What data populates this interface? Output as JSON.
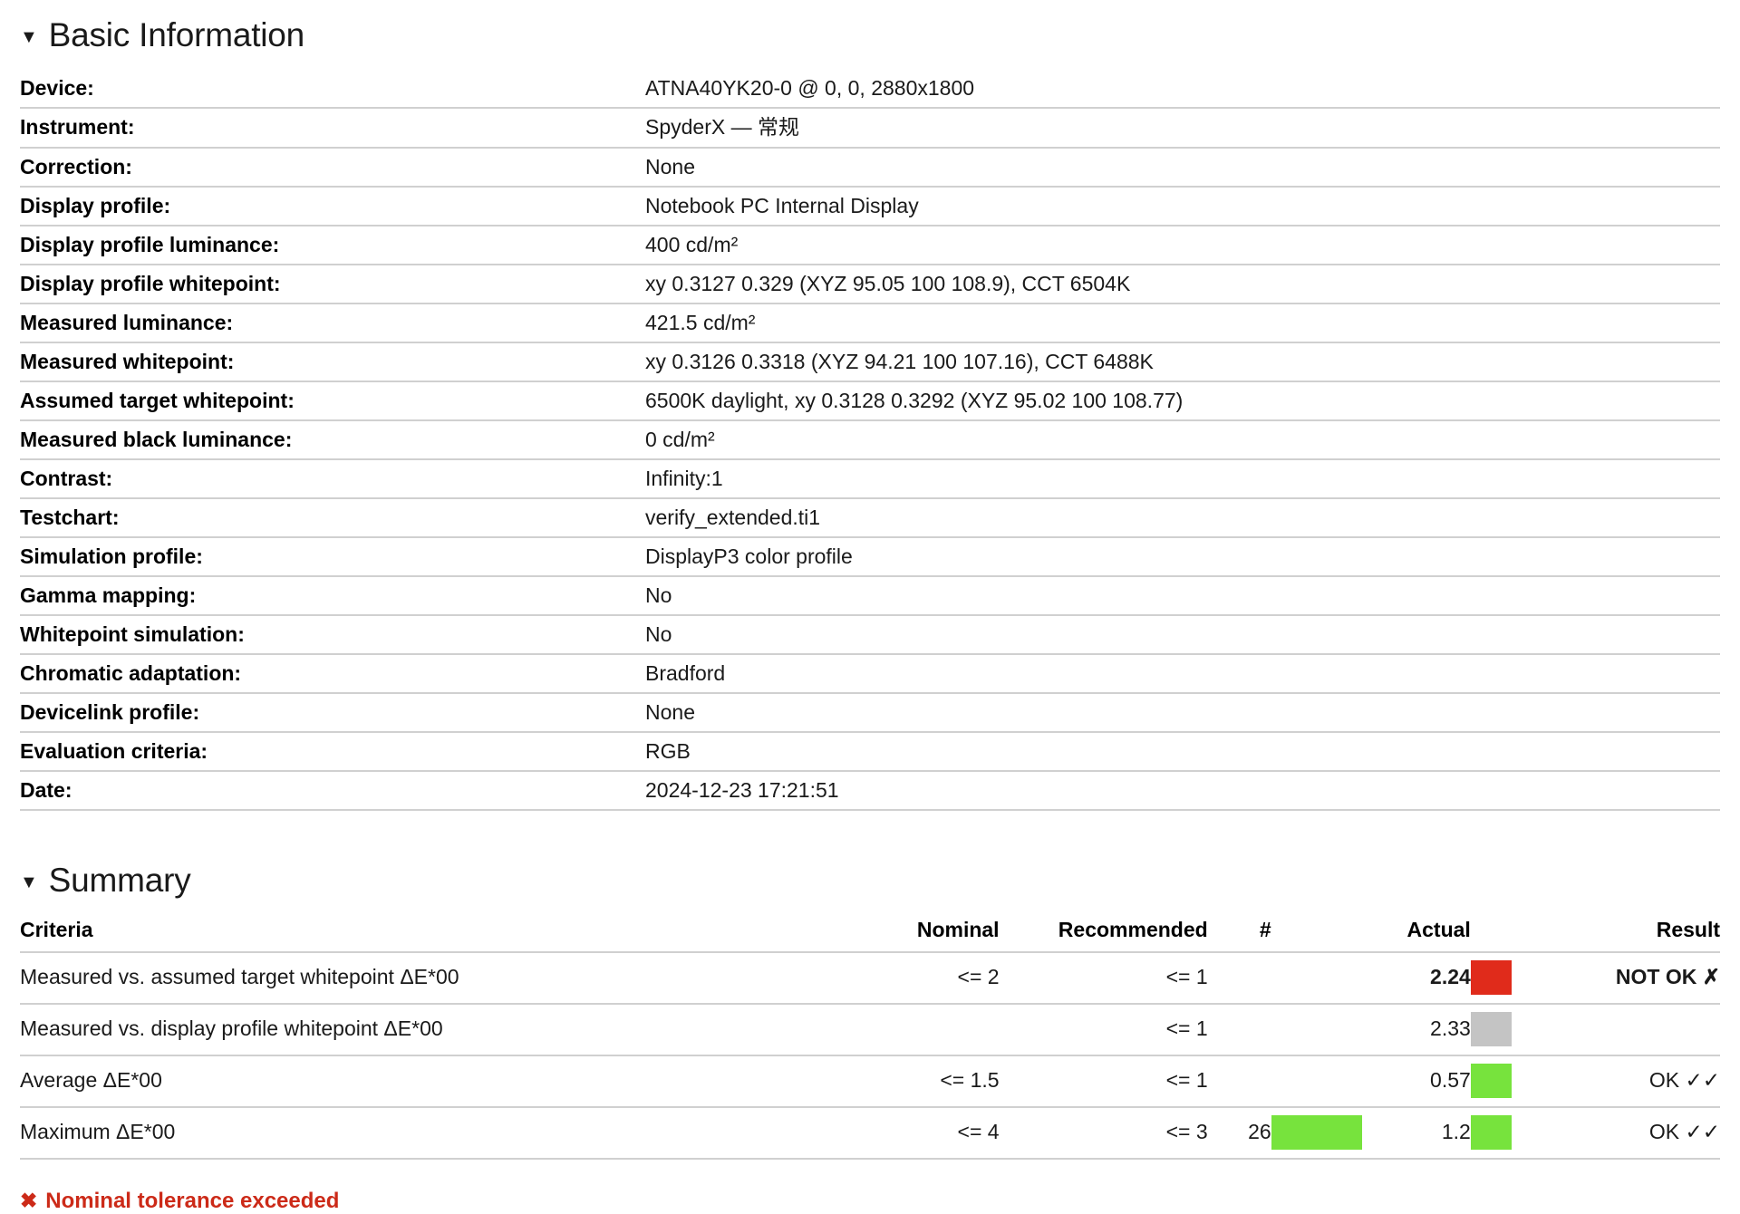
{
  "sections": {
    "basic": {
      "title": "Basic Information",
      "toggle_icon": "triangle-down-icon",
      "rows": [
        {
          "key": "Device:",
          "value": "ATNA40YK20-0 @ 0, 0, 2880x1800"
        },
        {
          "key": "Instrument:",
          "value": "SpyderX — 常规"
        },
        {
          "key": "Correction:",
          "value": "None"
        },
        {
          "key": "Display profile:",
          "value": "Notebook PC Internal Display"
        },
        {
          "key": "Display profile luminance:",
          "value": "400 cd/m²"
        },
        {
          "key": "Display profile whitepoint:",
          "value": "xy 0.3127 0.329 (XYZ 95.05 100 108.9), CCT 6504K"
        },
        {
          "key": "Measured luminance:",
          "value": "421.5 cd/m²"
        },
        {
          "key": "Measured whitepoint:",
          "value": "xy 0.3126 0.3318 (XYZ 94.21 100 107.16), CCT 6488K"
        },
        {
          "key": "Assumed target whitepoint:",
          "value": "6500K daylight, xy 0.3128 0.3292 (XYZ 95.02 100 108.77)"
        },
        {
          "key": "Measured black luminance:",
          "value": "0 cd/m²"
        },
        {
          "key": "Contrast:",
          "value": "Infinity:1"
        },
        {
          "key": "Testchart:",
          "value": "verify_extended.ti1"
        },
        {
          "key": "Simulation profile:",
          "value": "DisplayP3 color profile"
        },
        {
          "key": "Gamma mapping:",
          "value": "No"
        },
        {
          "key": "Whitepoint simulation:",
          "value": "No"
        },
        {
          "key": "Chromatic adaptation:",
          "value": "Bradford"
        },
        {
          "key": "Devicelink profile:",
          "value": "None"
        },
        {
          "key": "Evaluation criteria:",
          "value": "RGB"
        },
        {
          "key": "Date:",
          "value": "2024-12-23 17:21:51"
        }
      ]
    },
    "summary": {
      "title": "Summary",
      "toggle_icon": "triangle-down-icon",
      "headers": {
        "criteria": "Criteria",
        "nominal": "Nominal",
        "recommended": "Recommended",
        "count": "#",
        "actual": "Actual",
        "result": "Result"
      },
      "rows": [
        {
          "criteria": "Measured vs. assumed target whitepoint ΔE*00",
          "nominal": "<= 2",
          "recommended": "<= 1",
          "count": "",
          "actual": "2.24",
          "result": "NOT OK ✗",
          "bar_left_color": "",
          "bar_right_color": "#e02b1b",
          "actual_style": "bad",
          "result_style": "bad"
        },
        {
          "criteria": "Measured vs. display profile whitepoint ΔE*00",
          "nominal": "",
          "recommended": "<= 1",
          "count": "",
          "actual": "2.33",
          "result": "",
          "bar_left_color": "",
          "bar_right_color": "#c4c4c4",
          "actual_style": "gray",
          "result_style": "none"
        },
        {
          "criteria": "Average ΔE*00",
          "nominal": "<= 1.5",
          "recommended": "<= 1",
          "count": "",
          "actual": "0.57",
          "result": "OK ✓✓",
          "bar_left_color": "",
          "bar_right_color": "#77e33d",
          "actual_style": "good",
          "result_style": "good"
        },
        {
          "criteria": "Maximum ΔE*00",
          "nominal": "<= 4",
          "recommended": "<= 3",
          "count": "26",
          "actual": "1.2",
          "result": "OK ✓✓",
          "bar_left_color": "#77e33d",
          "bar_right_color": "#77e33d",
          "actual_style": "good",
          "result_style": "good"
        }
      ]
    }
  },
  "footer": {
    "icon": "x-mark-icon",
    "text": "Nominal tolerance exceeded",
    "color": "#cc2a18"
  }
}
